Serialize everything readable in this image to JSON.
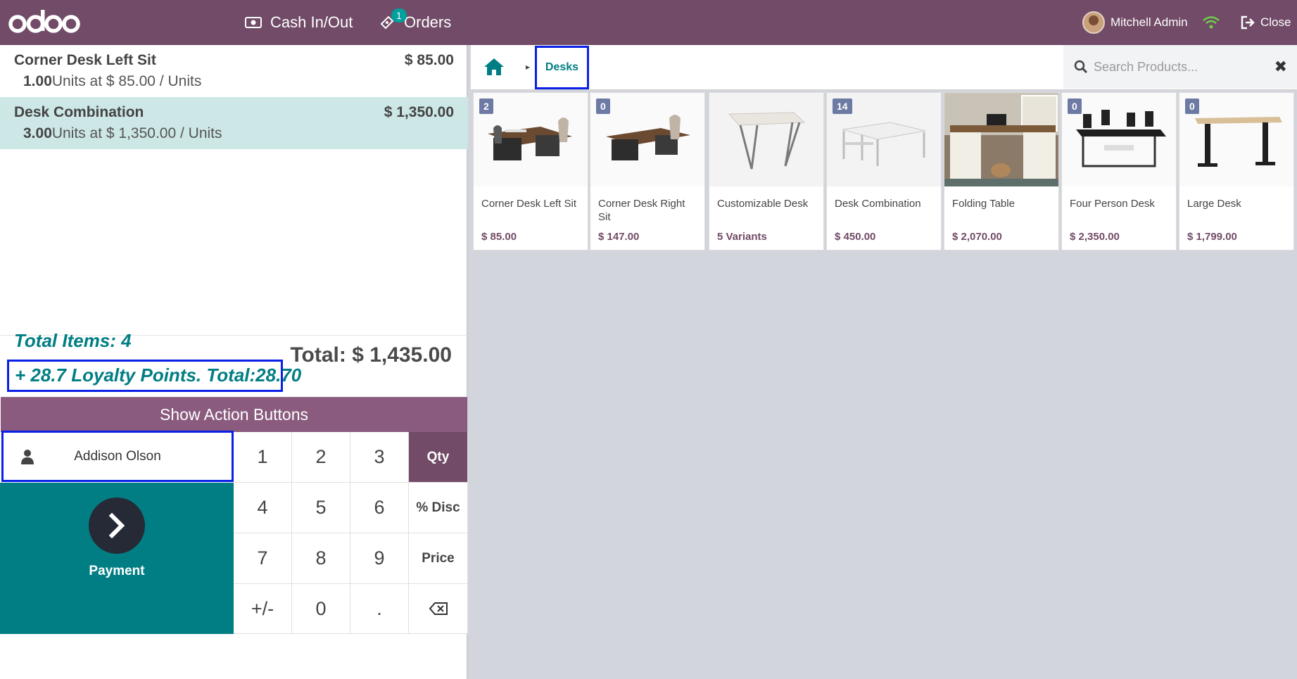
{
  "topbar": {
    "logo": "odoo",
    "cash_label": "Cash In/Out",
    "orders_label": "Orders",
    "orders_badge": "1",
    "user_name": "Mitchell Admin",
    "close_label": "Close"
  },
  "order": {
    "lines": [
      {
        "name": "Corner Desk Left Sit",
        "price": "$ 85.00",
        "qty": "1.00",
        "info": "Units at $ 85.00 / Units",
        "selected": false
      },
      {
        "name": "Desk Combination",
        "price": "$ 1,350.00",
        "qty": "3.00",
        "info": "Units at $ 1,350.00 / Units",
        "selected": true
      }
    ],
    "total": "Total: $ 1,435.00",
    "total_items": "Total Items: 4",
    "loyalty": "+ 28.7 Loyalty Points. Total:28.70"
  },
  "controls": {
    "action_buttons": "Show Action Buttons",
    "customer": "Addison Olson",
    "payment": "Payment",
    "keys": [
      "1",
      "2",
      "3",
      "Qty",
      "4",
      "5",
      "6",
      "% Disc",
      "7",
      "8",
      "9",
      "Price",
      "+/-",
      "0",
      "."
    ],
    "active_mode": "Qty"
  },
  "products_panel": {
    "breadcrumb": "Desks",
    "search_placeholder": "Search Products...",
    "products": [
      {
        "badge": "2",
        "name": "Corner Desk Left Sit",
        "price": "$ 85.00"
      },
      {
        "badge": "0",
        "name": "Corner Desk Right Sit",
        "price": "$ 147.00"
      },
      {
        "badge": "",
        "name": "Customizable Desk",
        "price": "5 Variants"
      },
      {
        "badge": "14",
        "name": "Desk Combination",
        "price": "$ 450.00"
      },
      {
        "badge": "",
        "name": "Folding Table",
        "price": "$ 2,070.00"
      },
      {
        "badge": "0",
        "name": "Four Person Desk",
        "price": "$ 2,350.00"
      },
      {
        "badge": "0",
        "name": "Large Desk",
        "price": "$ 1,799.00"
      }
    ]
  },
  "colors": {
    "brand": "#714b67",
    "accent": "#017e84",
    "highlight": "#0a20e6"
  }
}
